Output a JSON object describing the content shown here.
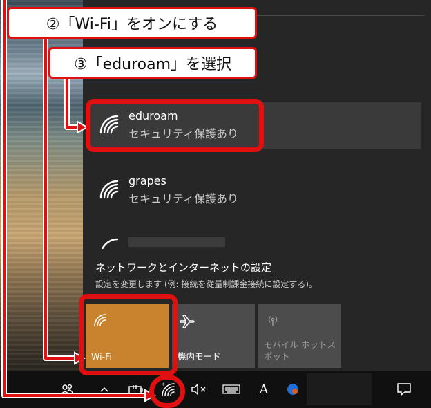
{
  "networks": [
    {
      "name": "eduroam",
      "security": "セキュリティ保護あり",
      "selected": true
    },
    {
      "name": "grapes",
      "security": "セキュリティ保護あり",
      "selected": false
    }
  ],
  "settings": {
    "link": "ネットワークとインターネットの設定",
    "description": "設定を変更します (例: 接続を従量制課金接続に設定する)。"
  },
  "quick_actions": [
    {
      "label": "Wi-Fi",
      "state": "on",
      "icon": "wifi-icon"
    },
    {
      "label": "機内モード",
      "state": "off",
      "icon": "airplane-icon"
    },
    {
      "label": "モバイル ホットスポット",
      "state": "disabled",
      "icon": "mobile-hotspot-icon"
    }
  ],
  "taskbar": {
    "icons": [
      "people-icon",
      "chevron-up-icon",
      "battery-icon",
      "wifi-icon",
      "volume-mute-icon",
      "keyboard-icon",
      "ime-icon",
      "app-icon",
      "notification-icon"
    ],
    "ime_label": "A"
  },
  "annotations": {
    "step2": "②「Wi-Fi」をオンにする",
    "step3": "③「eduroam」を選択"
  },
  "colors": {
    "accent": "#c9822d",
    "annotation": "#e01010",
    "flyout_bg": "#262626"
  }
}
